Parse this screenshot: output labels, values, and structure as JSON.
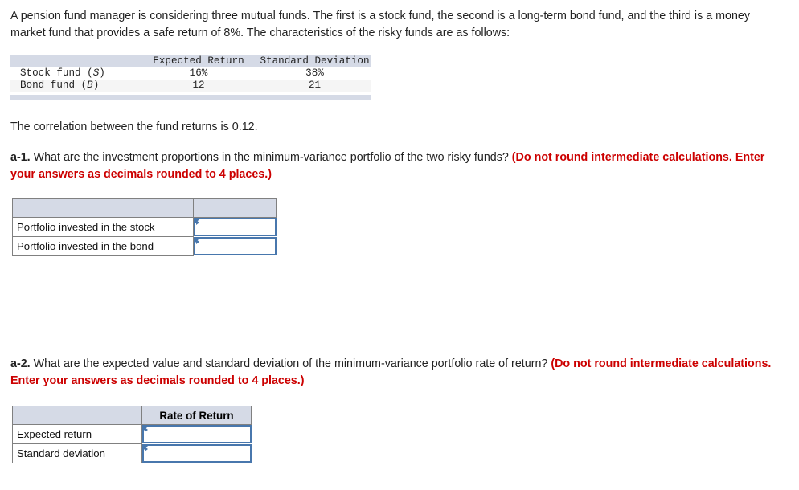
{
  "intro": {
    "text": "A pension fund manager is considering three mutual funds. The first is a stock fund, the second is a long-term bond fund, and the third is a money market fund that provides a safe return of 8%. The characteristics of the risky funds are as follows:"
  },
  "fund_table": {
    "columns": [
      "",
      "Expected Return",
      "Standard Deviation"
    ],
    "rows": [
      {
        "name": "Stock fund (",
        "symbol": "S",
        "name_end": ")",
        "expected_return": "16%",
        "standard_deviation": "38%"
      },
      {
        "name": "Bond fund (",
        "symbol": "B",
        "name_end": ")",
        "expected_return": "12",
        "standard_deviation": "21"
      }
    ]
  },
  "correlation": {
    "text": "The correlation between the fund returns is 0.12."
  },
  "question_a1": {
    "tag": "a-1.",
    "body": " What are the investment proportions in the minimum-variance portfolio of the two risky funds? ",
    "warning": "(Do not round intermediate calculations. Enter your answers as decimals rounded to 4 places.)"
  },
  "answer_table_1": {
    "header_col1": "",
    "header_col2": "",
    "rows": [
      {
        "label": "Portfolio invested in the stock",
        "value": "",
        "placeholder": ""
      },
      {
        "label": "Portfolio invested in the bond",
        "value": "",
        "placeholder": ""
      }
    ]
  },
  "question_a2": {
    "tag": "a-2.",
    "body": " What are the expected value and standard deviation of the minimum-variance portfolio rate of return? ",
    "warning": "(Do not round intermediate calculations. Enter your answers as decimals rounded to 4 places.)"
  },
  "answer_table_2": {
    "header_col1": "",
    "header_col2": "Rate of Return",
    "rows": [
      {
        "label": "Expected return",
        "value": "",
        "placeholder": ""
      },
      {
        "label": "Standard deviation",
        "value": "",
        "placeholder": ""
      }
    ]
  },
  "colors": {
    "header_fill": "#d5dae6",
    "input_border": "#4877ad",
    "warning_text": "#cc0000",
    "row_alt_fill": "#f5f5f5",
    "table_border": "#808080"
  }
}
